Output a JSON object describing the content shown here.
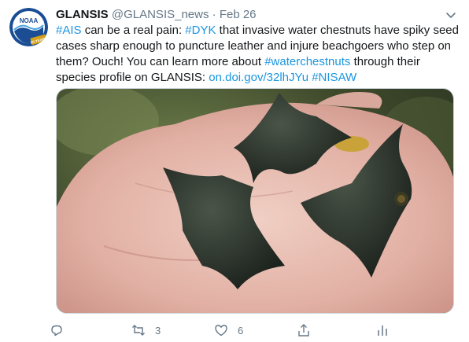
{
  "tweet": {
    "author": {
      "name": "GLANSIS",
      "handle": "@GLANSIS_news",
      "separator": "·",
      "date": "Feb 26",
      "avatar": {
        "text": "NOAA",
        "badge": "50 YEARS"
      }
    },
    "text": {
      "hashtag_ais": "#AIS",
      "part1": " can be a real pain: ",
      "hashtag_dyk": "#DYK",
      "part2": " that invasive water chestnuts have spiky seed cases sharp enough to puncture leather and injure beachgoers who step on them? Ouch! You can learn more about ",
      "hashtag_waterchestnuts": "#waterchestnuts",
      "part3": " through their species profile on GLANSIS: ",
      "link": "on.doi.gov/32lhJYu",
      "space": " ",
      "hashtag_nisaw": "#NISAW"
    },
    "actions": {
      "reply_count": "",
      "retweet_count": "3",
      "like_count": "6"
    },
    "colors": {
      "link": "#1b95e0",
      "muted": "#657786",
      "text": "#14171a"
    }
  }
}
